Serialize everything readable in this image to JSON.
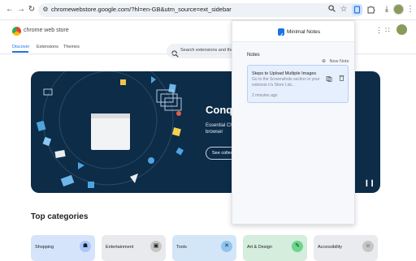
{
  "browser": {
    "url": "chromewebstore.google.com/?hl=en-GB&utm_source=ext_sidebar"
  },
  "store": {
    "logo_text": "chrome web store",
    "search_placeholder": "Search extensions and them",
    "tabs": [
      {
        "label": "Discover",
        "active": true
      },
      {
        "label": "Extensions",
        "active": false
      },
      {
        "label": "Themes",
        "active": false
      }
    ]
  },
  "hero": {
    "title": "Conqu",
    "subtitle": "Essential Chro browser",
    "button_label": "See collect"
  },
  "categories": {
    "title": "Top categories",
    "items": [
      {
        "label": "Shopping",
        "icon": "bag-icon",
        "bg": "#d6e4fb",
        "icon_bg": "#a8c7fa"
      },
      {
        "label": "Entertainment",
        "icon": "calendar-icon",
        "bg": "#e8eaed",
        "icon_bg": "#c4c7c5"
      },
      {
        "label": "Tools",
        "icon": "tools-icon",
        "bg": "#d3e6f7",
        "icon_bg": "#8ec5f0"
      },
      {
        "label": "Art & Design",
        "icon": "pencil-icon",
        "bg": "#d4eddc",
        "icon_bg": "#6dd58c"
      },
      {
        "label": "Accessibility",
        "icon": "person-icon",
        "bg": "#e9ebee",
        "icon_bg": "#c4c7c5"
      }
    ]
  },
  "popup": {
    "app_name": "Minimal Notes",
    "notes_label": "Notes",
    "new_note_label": "New Note",
    "notes": [
      {
        "title": "Steps to Upload Multiple Images",
        "preview": "Go to the Screenshots section in your extensio n's Store List...",
        "time": "2 minutes ago"
      }
    ]
  },
  "colors": {
    "accent": "#1a73e8",
    "hero_bg": "#0c2c48"
  }
}
